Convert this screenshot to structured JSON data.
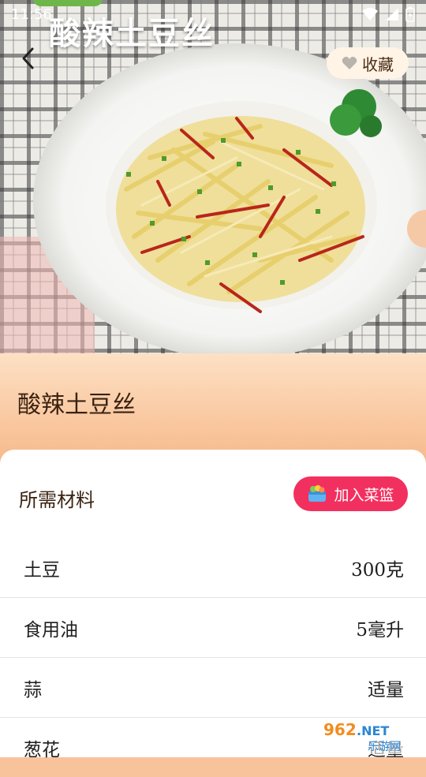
{
  "status_bar": {
    "time": "11:56"
  },
  "hero": {
    "overlay_title": "酸辣土豆丝",
    "favorite_label": "收藏"
  },
  "recipe": {
    "title": "酸辣土豆丝"
  },
  "ingredients": {
    "section_title": "所需材料",
    "add_to_basket_label": "加入菜篮",
    "items": [
      {
        "name": "土豆",
        "amount": "300克"
      },
      {
        "name": "食用油",
        "amount": "5毫升"
      },
      {
        "name": "蒜",
        "amount": "适量"
      },
      {
        "name": "葱花",
        "amount": "适量"
      }
    ]
  },
  "watermark": {
    "text_top": "962.NET",
    "text_bottom": "乐游网"
  },
  "colors": {
    "accent": "#f2305f",
    "background": "#f8c39a",
    "favorite_bg": "#fff4e5"
  }
}
